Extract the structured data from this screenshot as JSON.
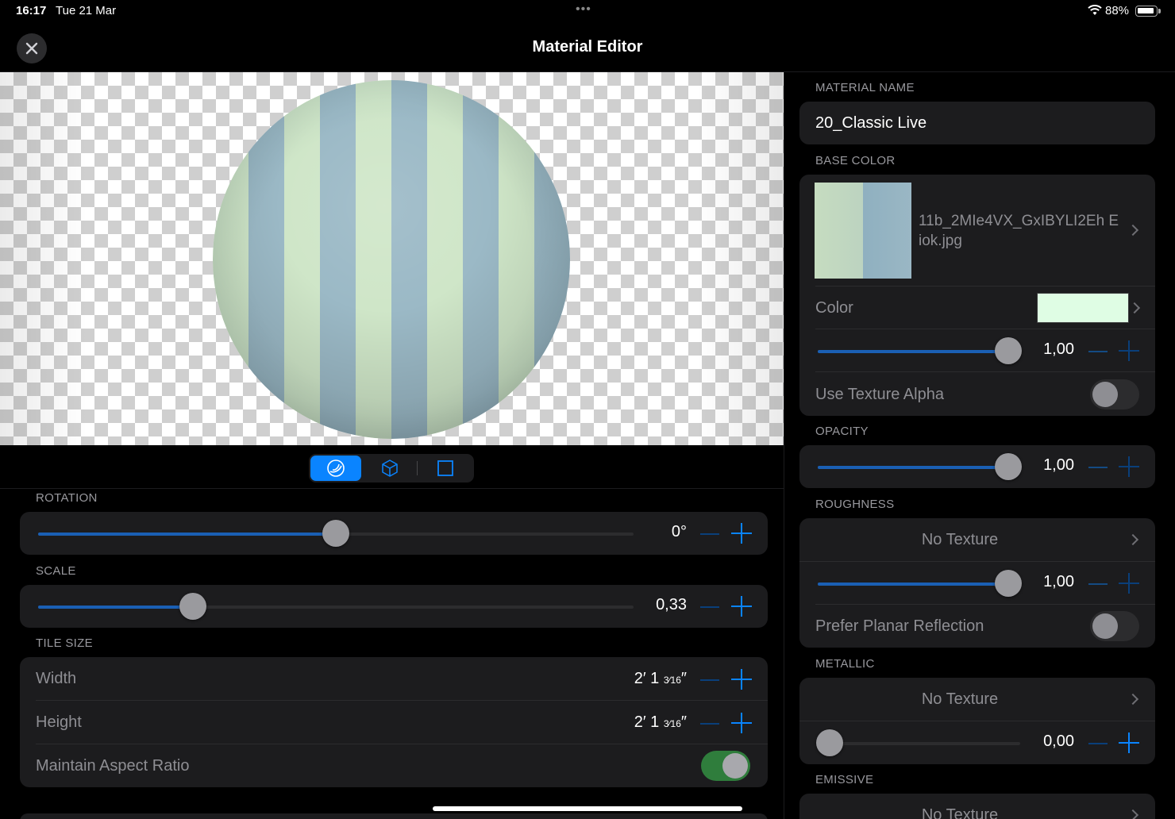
{
  "status": {
    "time": "16:17",
    "date": "Tue 21 Mar",
    "dots": "•••",
    "battery": "88%"
  },
  "nav": {
    "title": "Material Editor"
  },
  "left": {
    "rotation": {
      "label": "ROTATION",
      "value": "0°",
      "fraction": 0.5
    },
    "scale": {
      "label": "SCALE",
      "value": "0,33",
      "fraction": 0.26
    },
    "tile_size": {
      "label": "TILE SIZE",
      "width_label": "Width",
      "width_value": "2′ 1",
      "width_frac": "3⁄16",
      "width_unit": "″",
      "height_label": "Height",
      "height_value": "2′ 1",
      "height_frac": "3⁄16",
      "height_unit": "″",
      "aspect_label": "Maintain Aspect Ratio",
      "aspect_on": true
    }
  },
  "right": {
    "material_name_label": "MATERIAL NAME",
    "material_name": "20_Classic Live",
    "base_color_label": "BASE COLOR",
    "texture_file": "11b_2MIe4VX_GxIBYLI2Eh Eiok.jpg",
    "color_label": "Color",
    "color_swatch": "#dffde4",
    "base_value": "1,00",
    "use_alpha_label": "Use Texture Alpha",
    "opacity_label": "OPACITY",
    "opacity_value": "1,00",
    "roughness_label": "ROUGHNESS",
    "roughness_texture": "No Texture",
    "roughness_value": "1,00",
    "planar_label": "Prefer Planar Reflection",
    "metallic_label": "METALLIC",
    "metallic_texture": "No Texture",
    "metallic_value": "0,00",
    "emissive_label": "EMISSIVE",
    "emissive_texture": "No Texture"
  }
}
